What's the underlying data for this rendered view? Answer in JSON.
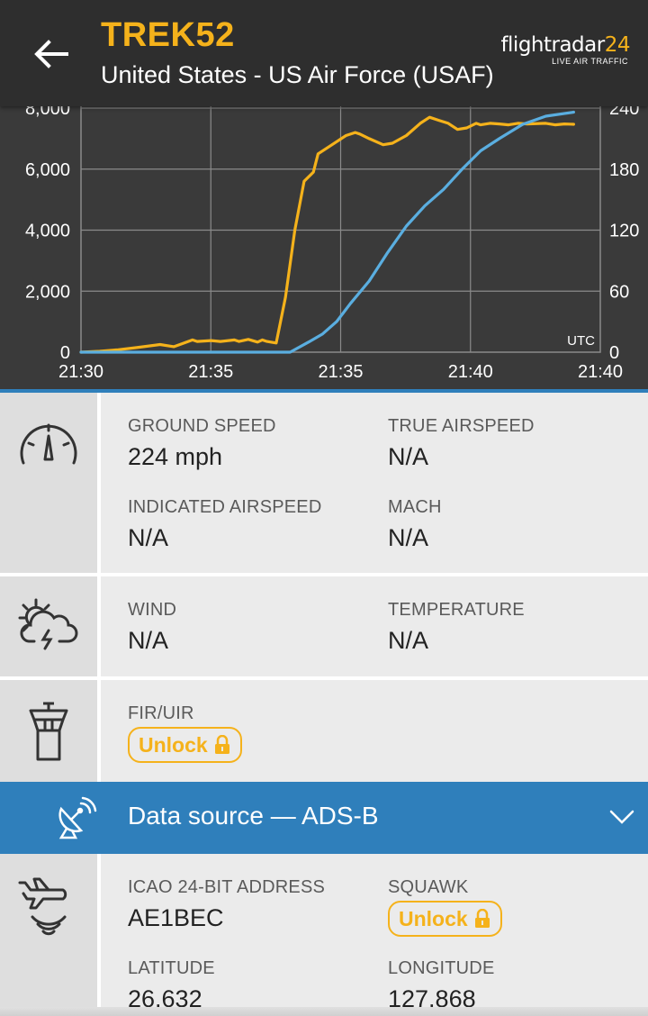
{
  "header": {
    "title": "TREK52",
    "subtitle": "United States - US Air Force (USAF)",
    "logo_main": "flightradar",
    "logo_num": "24",
    "logo_sub": "LIVE AIR TRAFFIC"
  },
  "chart_data": {
    "type": "line",
    "x_tick_labels": [
      "21:30",
      "21:35",
      "21:35",
      "21:40",
      "21:40"
    ],
    "y_left_ticks": [
      "0",
      "2,000",
      "4,000",
      "6,000",
      "8,000"
    ],
    "y_right_ticks": [
      "0",
      "60",
      "120",
      "180",
      "240"
    ],
    "x_unit_label": "UTC",
    "y_left_range": [
      0,
      8000
    ],
    "y_right_range": [
      0,
      240
    ],
    "grid": true,
    "series": [
      {
        "color": "#f5b21b",
        "axis": "left",
        "x": [
          0,
          0.04,
          0.08,
          0.12,
          0.17,
          0.2,
          0.24,
          0.25,
          0.28,
          0.3,
          0.33,
          0.34,
          0.36,
          0.38,
          0.39,
          0.4,
          0.42,
          0.44,
          0.46,
          0.48,
          0.5,
          0.51,
          0.54,
          0.57,
          0.59,
          0.6,
          0.62,
          0.65,
          0.67,
          0.7,
          0.73,
          0.75,
          0.77,
          0.79,
          0.81,
          0.83,
          0.85,
          0.86,
          0.88,
          0.9,
          0.92,
          0.94,
          0.96,
          1.0,
          1.02,
          1.04,
          1.06
        ],
        "y": [
          0,
          30,
          80,
          150,
          250,
          180,
          400,
          350,
          380,
          350,
          400,
          350,
          420,
          330,
          400,
          350,
          300,
          1800,
          4000,
          5600,
          5900,
          6500,
          6800,
          7100,
          7200,
          7150,
          7000,
          6800,
          6850,
          7100,
          7500,
          7700,
          7600,
          7500,
          7300,
          7350,
          7500,
          7450,
          7500,
          7480,
          7450,
          7500,
          7480,
          7500,
          7450,
          7480,
          7470
        ],
        "x_scale": "norm"
      },
      {
        "color": "#5aaee0",
        "axis": "right",
        "x": [
          0,
          0.45,
          0.49,
          0.52,
          0.55,
          0.58,
          0.62,
          0.66,
          0.7,
          0.74,
          0.78,
          0.82,
          0.86,
          0.9,
          0.95,
          1.0,
          1.06
        ],
        "y": [
          0,
          0,
          10,
          18,
          30,
          48,
          70,
          98,
          124,
          144,
          160,
          180,
          198,
          210,
          224,
          232,
          236
        ],
        "x_scale": "norm"
      }
    ]
  },
  "speed": {
    "ground_speed_label": "GROUND SPEED",
    "ground_speed_value": "224 mph",
    "true_airspeed_label": "TRUE AIRSPEED",
    "true_airspeed_value": "N/A",
    "indicated_airspeed_label": "INDICATED AIRSPEED",
    "indicated_airspeed_value": "N/A",
    "mach_label": "MACH",
    "mach_value": "N/A"
  },
  "weather": {
    "wind_label": "WIND",
    "wind_value": "N/A",
    "temperature_label": "TEMPERATURE",
    "temperature_value": "N/A"
  },
  "fir": {
    "label": "FIR/UIR",
    "unlock_label": "Unlock"
  },
  "data_source": {
    "label": "Data source — ADS-B"
  },
  "transponder": {
    "icao_label": "ICAO 24-BIT ADDRESS",
    "icao_value": "AE1BEC",
    "squawk_label": "SQUAWK",
    "squawk_unlock_label": "Unlock",
    "latitude_label": "LATITUDE",
    "latitude_value": "26.632",
    "longitude_label": "LONGITUDE",
    "longitude_value": "127.868"
  },
  "colors": {
    "accent": "#f5b21b",
    "header_bg": "#2e2e2e",
    "data_source_bar": "#2f7fbb",
    "altitude_line": "#f5b21b",
    "speed_line": "#5aaee0"
  }
}
